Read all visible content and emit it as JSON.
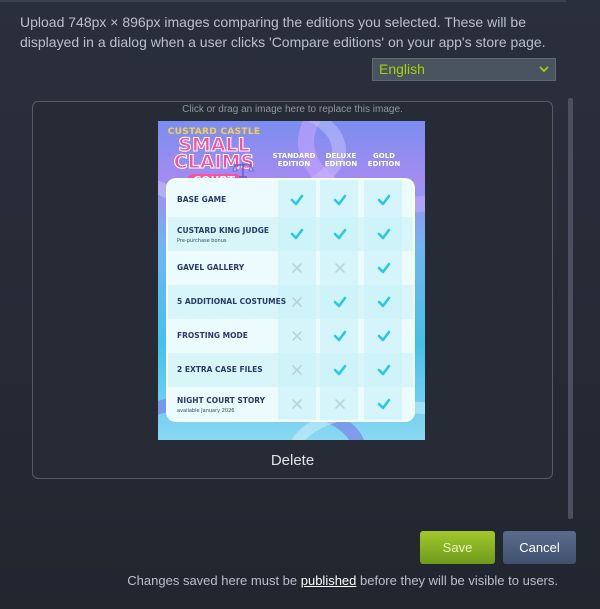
{
  "description": "Upload 748px × 896px images comparing the editions you selected. These will be displayed in a dialog when a user clicks 'Compare editions' on your app's store page.",
  "language_select": {
    "value": "English"
  },
  "upload_hint": "Click or drag an image here to replace this image.",
  "image": {
    "logo_line1": "CUSTARD CASTLE",
    "logo_line2a": "SMALL",
    "logo_line2b": "CLAIMS",
    "logo_line3": "COURT",
    "columns": [
      "STANDARD EDITION",
      "DELUXE EDITION",
      "GOLD EDITION"
    ],
    "rows": [
      {
        "label": "BASE GAME",
        "sub": "",
        "marks": [
          "check",
          "check",
          "check"
        ]
      },
      {
        "label": "CUSTARD KING JUDGE",
        "sub": "Pre-purchase bonus",
        "marks": [
          "check",
          "check",
          "check"
        ]
      },
      {
        "label": "GAVEL GALLERY",
        "sub": "",
        "marks": [
          "x",
          "x",
          "check"
        ]
      },
      {
        "label": "5 ADDITIONAL COSTUMES",
        "sub": "",
        "marks": [
          "x",
          "check",
          "check"
        ]
      },
      {
        "label": "FROSTING MODE",
        "sub": "",
        "marks": [
          "x",
          "check",
          "check"
        ]
      },
      {
        "label": "2 EXTRA CASE FILES",
        "sub": "",
        "marks": [
          "x",
          "check",
          "check"
        ]
      },
      {
        "label": "NIGHT COURT STORY",
        "sub": "available January 2026",
        "marks": [
          "x",
          "x",
          "check"
        ]
      }
    ]
  },
  "delete_label": "Delete",
  "save_label": "Save",
  "cancel_label": "Cancel",
  "footer": {
    "before": "Changes saved here must be ",
    "link": "published",
    "after": " before they will be visible to users."
  },
  "colors": {
    "accent": "#a4d007",
    "check": "#29c8ea",
    "x": "#b8d4da"
  },
  "icons": {
    "select": "chevron-down-icon",
    "check": "check-icon",
    "x": "x-icon"
  }
}
